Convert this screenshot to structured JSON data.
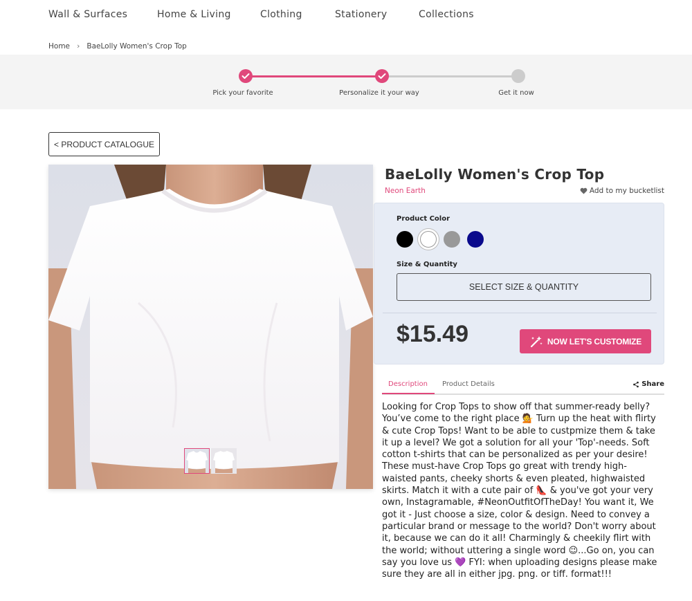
{
  "nav": {
    "items": [
      {
        "label": "Wall & Surfaces"
      },
      {
        "label": "Home & Living"
      },
      {
        "label": "Clothing"
      },
      {
        "label": "Stationery"
      },
      {
        "label": "Collections"
      }
    ]
  },
  "breadcrumb": {
    "home": "Home",
    "current": "BaeLolly Women's Crop Top"
  },
  "stepper": {
    "steps": [
      {
        "label": "Pick your favorite",
        "state": "complete"
      },
      {
        "label": "Personalize it your way",
        "state": "complete"
      },
      {
        "label": "Get it now",
        "state": "pending"
      }
    ],
    "active_color": "#e0487b"
  },
  "catalogue_button": "< PRODUCT CATALOGUE",
  "product": {
    "title": "BaeLolly Women's Crop Top",
    "brand": "Neon Earth",
    "bucketlist_label": "Add to my bucketlist",
    "color_label": "Product Color",
    "colors": [
      {
        "name": "black",
        "hex": "#000000"
      },
      {
        "name": "white",
        "hex": "#ffffff",
        "selected": true
      },
      {
        "name": "grey",
        "hex": "#999999"
      },
      {
        "name": "navy",
        "hex": "#0a0a8c"
      }
    ],
    "size_label": "Size & Quantity",
    "select_size_button": "SELECT SIZE & QUANTITY",
    "price": "$15.49",
    "customize_button": "NOW LET'S CUSTOMIZE"
  },
  "tabs": {
    "description": "Description",
    "details": "Product Details",
    "share": "Share"
  },
  "description": "Looking for Crop Tops to show off that summer-ready belly? You’ve come to the right place 💁 Turn up the heat with flirty & cute Crop Tops! Want to be able to custpmize them & take it up a level? We got a solution for all your 'Top'-needs. Soft cotton t-shirts that can be personalized as per your desire! These must-have Crop Tops go great with trendy high-waisted pants, cheeky shorts & even pleated, highwaisted skirts. Match it with a cute pair of 👠 & you've got your very own, Instagramable, #NeonOutfitOfTheDay! You want it, We got it - Just choose a size, color & design. Need to convey a particular brand or message to the world? Don't worry about it, because we can do it all! Charmingly & cheekily flirt with the world; without uttering a single word 😉...Go on, you can say you love us 💜 FYI: when uploading designs please make sure they are all in either jpg. png. or tiff. format!!!"
}
